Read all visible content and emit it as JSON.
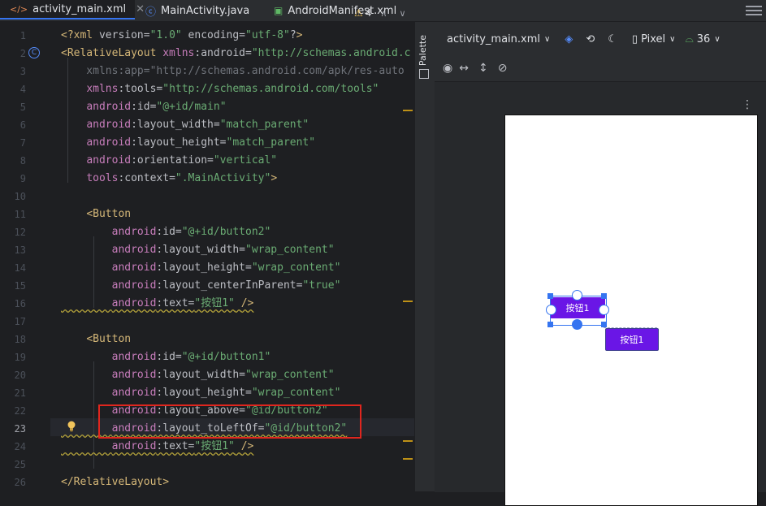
{
  "tabs": [
    {
      "label": "activity_main.xml",
      "icon": "xml-icon",
      "active": true
    },
    {
      "label": "MainActivity.java",
      "icon": "class-icon",
      "active": false
    },
    {
      "label": "AndroidManifest.xml",
      "icon": "manifest-icon",
      "active": false
    }
  ],
  "editor": {
    "warning_count": "4",
    "current_line": 23,
    "line_numbers": [
      "1",
      "2",
      "3",
      "4",
      "5",
      "6",
      "7",
      "8",
      "9",
      "10",
      "11",
      "12",
      "13",
      "14",
      "15",
      "16",
      "17",
      "18",
      "19",
      "20",
      "21",
      "22",
      "23",
      "24",
      "25",
      "26"
    ],
    "lines": [
      "<?xml version=\"1.0\" encoding=\"utf-8\"?>",
      "<RelativeLayout xmlns:android=\"http://schemas.android.c",
      "    xmlns:app=\"http://schemas.android.com/apk/res-auto",
      "    xmlns:tools=\"http://schemas.android.com/tools\"",
      "    android:id=\"@+id/main\"",
      "    android:layout_width=\"match_parent\"",
      "    android:layout_height=\"match_parent\"",
      "    android:orientation=\"vertical\"",
      "    tools:context=\".MainActivity\">",
      "",
      "    <Button",
      "        android:id=\"@+id/button2\"",
      "        android:layout_width=\"wrap_content\"",
      "        android:layout_height=\"wrap_content\"",
      "        android:layout_centerInParent=\"true\"",
      "        android:text=\"按钮1\" />",
      "",
      "    <Button",
      "        android:id=\"@+id/button1\"",
      "        android:layout_width=\"wrap_content\"",
      "        android:layout_height=\"wrap_content\"",
      "        android:layout_above=\"@id/button2\"",
      "        android:layout_toLeftOf=\"@id/button2\"",
      "        android:text=\"按钮1\" />",
      "",
      "</RelativeLayout>"
    ]
  },
  "palette": {
    "label": "Palette"
  },
  "design_toolbar": {
    "file": "activity_main.xml",
    "device": "Pixel",
    "api": "36"
  },
  "preview": {
    "button_a_text": "按钮1",
    "button_b_text": "按钮1"
  },
  "colors": {
    "accent": "#3574f0",
    "button": "#6a16e6",
    "highlight_box": "#e0261e"
  }
}
